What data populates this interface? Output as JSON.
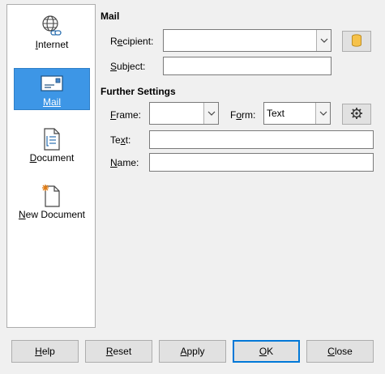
{
  "sidebar": {
    "items": [
      {
        "label_first": "I",
        "label_rest": "nternet",
        "icon": "globe-link-icon"
      },
      {
        "label_first": "M",
        "label_rest": "ail",
        "icon": "envelope-icon",
        "selected": true
      },
      {
        "label_first": "D",
        "label_rest": "ocument",
        "icon": "document-icon"
      },
      {
        "label_first": "N",
        "label_rest": "ew Document",
        "icon": "new-document-icon"
      }
    ]
  },
  "mail": {
    "section_title": "Mail",
    "recipient_label_pre": "R",
    "recipient_label_u": "e",
    "recipient_label_post": "cipient:",
    "recipient_value": "",
    "subject_label_first": "S",
    "subject_label_rest": "ubject:",
    "subject_value": ""
  },
  "further": {
    "section_title": "Further Settings",
    "frame_label_first": "F",
    "frame_label_rest": "rame:",
    "frame_value": "",
    "form_label_pre": "F",
    "form_label_u": "o",
    "form_label_post": "rm:",
    "form_value": "Text",
    "text_label_pre": "Te",
    "text_label_u": "x",
    "text_label_post": "t:",
    "text_value": "",
    "name_label_first": "N",
    "name_label_rest": "ame:",
    "name_value": ""
  },
  "buttons": {
    "help_first": "H",
    "help_rest": "elp",
    "reset_first": "R",
    "reset_rest": "eset",
    "apply_first": "A",
    "apply_rest": "pply",
    "ok_first": "O",
    "ok_rest": "K",
    "close_first": "C",
    "close_rest": "lose"
  },
  "colors": {
    "selected_bg": "#3d96e6",
    "default_border": "#0078d7"
  }
}
